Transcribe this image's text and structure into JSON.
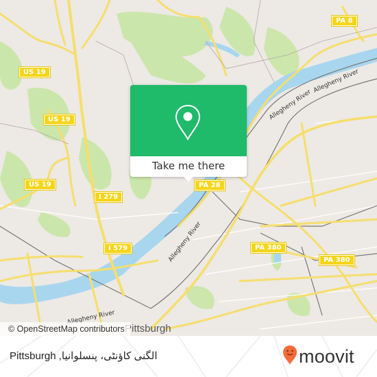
{
  "map": {
    "city_label": "Pittsburgh",
    "attribution": "© OpenStreetMap contributors",
    "route_shields": [
      {
        "label": "PA 8"
      },
      {
        "label": "US 19"
      },
      {
        "label": "US 19"
      },
      {
        "label": "US 19"
      },
      {
        "label": "I 279"
      },
      {
        "label": "PA 28"
      },
      {
        "label": "I 579"
      },
      {
        "label": "PA 380"
      },
      {
        "label": "PA 380"
      }
    ],
    "river_labels": [
      {
        "label": "Allegheny River"
      },
      {
        "label": "Allegheny River"
      },
      {
        "label": "Allegheny River"
      },
      {
        "label": "Allegheny River"
      }
    ],
    "colors": {
      "land": "#ede9e5",
      "park": "#c8e6a5",
      "water": "#a8d6ee",
      "road": "#f6de6c",
      "shield": "#f5d517"
    }
  },
  "popup": {
    "icon": "map-pin-icon",
    "button_label": "Take me there",
    "accent": "#1fba6a"
  },
  "footer": {
    "location_text": "Pittsburgh ,الگنی کاؤنٹی، پنسلوانیا",
    "brand_name": "moovit",
    "brand_icon": "moovit-pin-icon",
    "brand_color": "#f26b38"
  }
}
